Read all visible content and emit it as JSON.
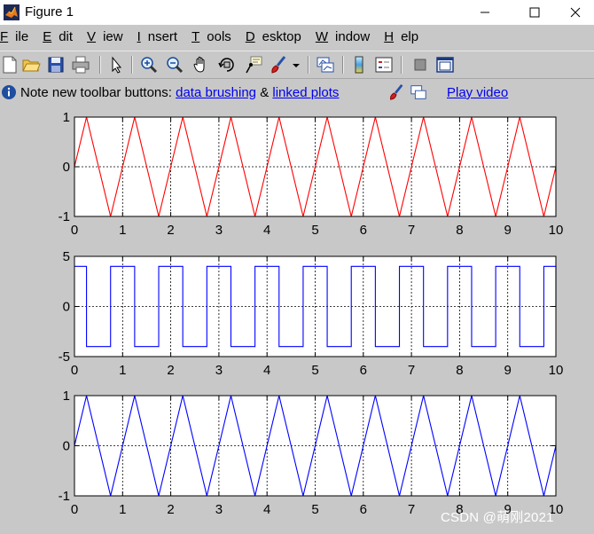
{
  "window": {
    "title": "Figure 1",
    "controls": [
      "minimize",
      "maximize",
      "close"
    ]
  },
  "menu": [
    {
      "mn": "F",
      "rest": "ile"
    },
    {
      "mn": "E",
      "rest": "dit"
    },
    {
      "mn": "V",
      "rest": "iew"
    },
    {
      "mn": "I",
      "rest": "nsert"
    },
    {
      "mn": "T",
      "rest": "ools"
    },
    {
      "mn": "D",
      "rest": "esktop"
    },
    {
      "mn": "W",
      "rest": "indow"
    },
    {
      "mn": "H",
      "rest": "elp"
    }
  ],
  "toolbar": {
    "icons": [
      "new-figure-icon",
      "open-file-icon",
      "save-icon",
      "print-icon",
      "edit-plot-arrow-icon",
      "zoom-in-icon",
      "zoom-out-icon",
      "pan-hand-icon",
      "rotate-3d-icon",
      "data-cursor-icon",
      "brush-icon",
      "brush-dropdown-icon",
      "link-plot-icon",
      "colorbar-icon",
      "legend-icon",
      "hide-plot-tools-icon",
      "show-plot-tools-icon"
    ]
  },
  "notice": {
    "text": "Note new toolbar buttons:",
    "link1": "data brushing",
    "amp": "&",
    "link2": "linked plots",
    "video": "Play video"
  },
  "watermark": "CSDN @萌刚2021",
  "chart_data": [
    {
      "type": "line",
      "title": "",
      "xlabel": "",
      "ylabel": "",
      "xlim": [
        0,
        10
      ],
      "ylim": [
        -1,
        1
      ],
      "xticks": [
        "0",
        "1",
        "2",
        "3",
        "4",
        "5",
        "6",
        "7",
        "8",
        "9",
        "10"
      ],
      "yticks": [
        "-1",
        "0",
        "1"
      ],
      "grid": true,
      "series": [
        {
          "color": "#ff0000",
          "waveform": "triangle",
          "amplitude": 1,
          "period": 1,
          "phase": 0,
          "x": [
            0,
            0.25,
            0.75,
            1.25,
            1.75,
            2.25,
            2.75,
            3.25,
            3.75,
            4.25,
            4.75,
            5.25,
            5.75,
            6.25,
            6.75,
            7.25,
            7.75,
            8.25,
            8.75,
            9.25,
            9.75,
            10
          ],
          "y": [
            0,
            1,
            -1,
            1,
            -1,
            1,
            -1,
            1,
            -1,
            1,
            -1,
            1,
            -1,
            1,
            -1,
            1,
            -1,
            1,
            -1,
            1,
            -1,
            0
          ]
        }
      ]
    },
    {
      "type": "line",
      "title": "",
      "xlabel": "",
      "ylabel": "",
      "xlim": [
        0,
        10
      ],
      "ylim": [
        -5,
        5
      ],
      "xticks": [
        "0",
        "1",
        "2",
        "3",
        "4",
        "5",
        "6",
        "7",
        "8",
        "9",
        "10"
      ],
      "yticks": [
        "-5",
        "0",
        "5"
      ],
      "grid": true,
      "series": [
        {
          "color": "#0000ff",
          "waveform": "square",
          "amplitude": 4,
          "period": 1,
          "x": [
            0,
            0.25,
            0.25,
            0.75,
            0.75,
            1.25,
            1.25,
            1.75,
            1.75,
            2.25,
            2.25,
            2.75,
            2.75,
            3.25,
            3.25,
            3.75,
            3.75,
            4.25,
            4.25,
            4.75,
            4.75,
            5.25,
            5.25,
            5.75,
            5.75,
            6.25,
            6.25,
            6.75,
            6.75,
            7.25,
            7.25,
            7.75,
            7.75,
            8.25,
            8.25,
            8.75,
            8.75,
            9.25,
            9.25,
            9.75,
            9.75,
            10,
            10
          ],
          "y": [
            4,
            4,
            -4,
            -4,
            4,
            4,
            -4,
            -4,
            4,
            4,
            -4,
            -4,
            4,
            4,
            -4,
            -4,
            4,
            4,
            -4,
            -4,
            4,
            4,
            -4,
            -4,
            4,
            4,
            -4,
            -4,
            4,
            4,
            -4,
            -4,
            4,
            4,
            -4,
            -4,
            4,
            4,
            -4,
            -4,
            4,
            4,
            0
          ]
        }
      ]
    },
    {
      "type": "line",
      "title": "",
      "xlabel": "",
      "ylabel": "",
      "xlim": [
        0,
        10
      ],
      "ylim": [
        -1,
        1
      ],
      "xticks": [
        "0",
        "1",
        "2",
        "3",
        "4",
        "5",
        "6",
        "7",
        "8",
        "9",
        "10"
      ],
      "yticks": [
        "-1",
        "0",
        "1"
      ],
      "grid": true,
      "series": [
        {
          "color": "#0000ff",
          "waveform": "triangle",
          "amplitude": 1,
          "period": 1,
          "phase": 0,
          "x": [
            0,
            0.25,
            0.75,
            1.25,
            1.75,
            2.25,
            2.75,
            3.25,
            3.75,
            4.25,
            4.75,
            5.25,
            5.75,
            6.25,
            6.75,
            7.25,
            7.75,
            8.25,
            8.75,
            9.25,
            9.75,
            10
          ],
          "y": [
            0,
            1,
            -1,
            1,
            -1,
            1,
            -1,
            1,
            -1,
            1,
            -1,
            1,
            -1,
            1,
            -1,
            1,
            -1,
            1,
            -1,
            1,
            -1,
            0
          ]
        }
      ]
    }
  ]
}
